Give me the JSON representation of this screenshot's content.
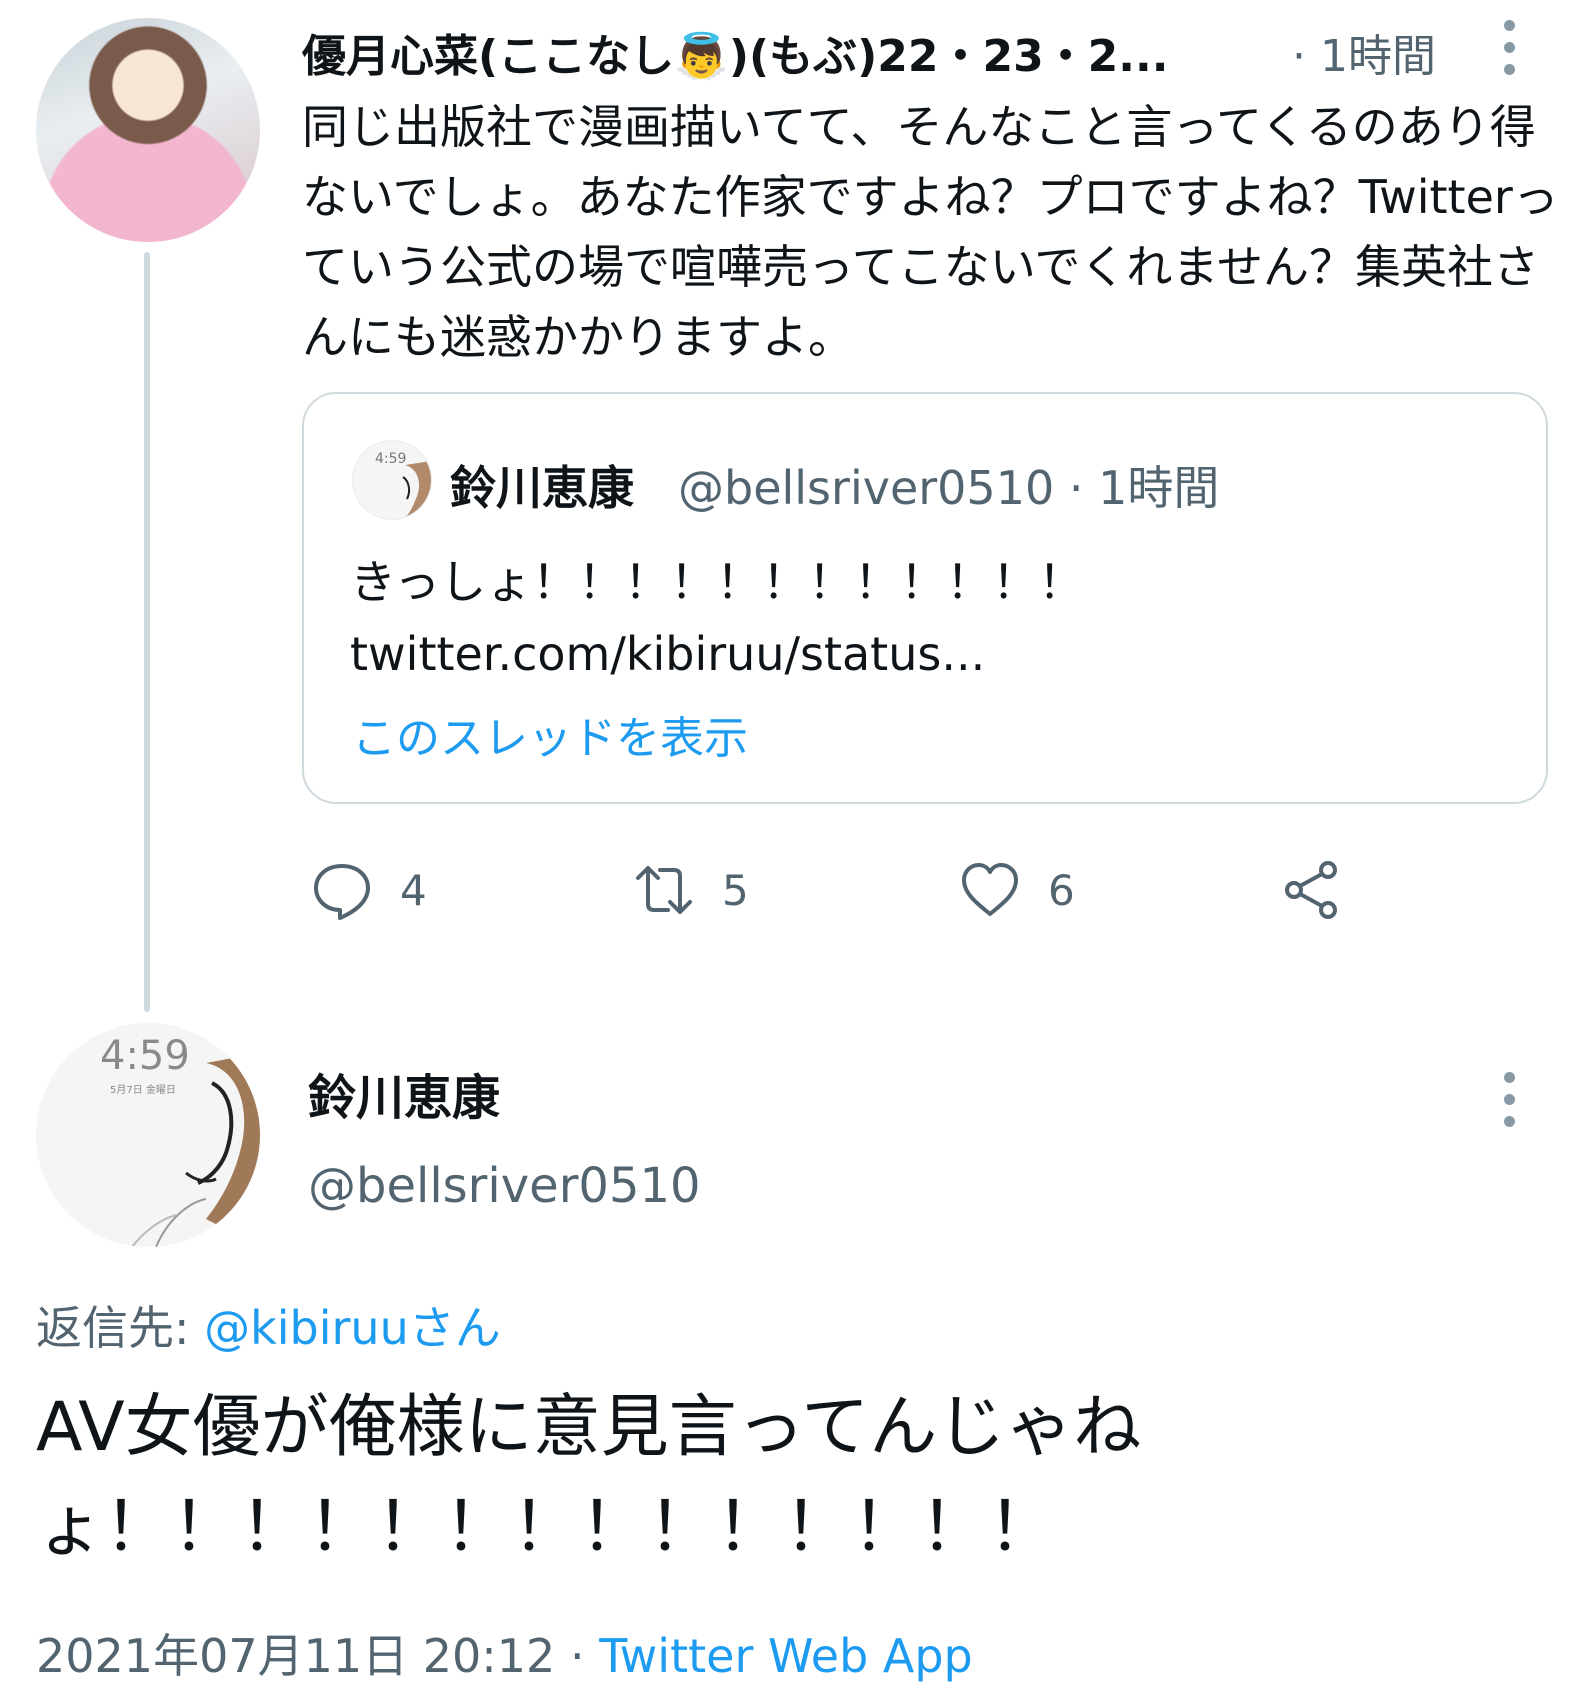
{
  "tweet1": {
    "display_name": "優月心菜(ここなし👼)(もぶ)22・23・2...",
    "time": "· 1時間",
    "text": "同じ出版社で漫画描いてて、そんなこと言ってくるのあり得ないでしょ。あなた作家ですよね？プロですよね？Twitterっていう公式の場で喧嘩売ってこないでくれません？集英社さんにも迷惑かかりますよ。",
    "quote": {
      "name": "鈴川恵康",
      "handle_time": "@bellsriver0510 · 1時間",
      "text": "きっしょ！！！！！！！！！！！！",
      "link": " twitter.com/kibiruu/status...",
      "show_thread": "このスレッドを表示",
      "avatar_clock": "4:59"
    },
    "actions": {
      "replies": "4",
      "retweets": "5",
      "likes": "6"
    }
  },
  "tweet2": {
    "display_name": "鈴川恵康",
    "handle": "@bellsriver0510",
    "avatar_clock": "4:59",
    "avatar_date": "5月7日 金曜日",
    "reply_label": "返信先: ",
    "reply_mention": "@kibiruuさん",
    "text": "AV女優が俺様に意見言ってんじゃねょ！！！！！！！！！！！！！！",
    "date": "2021年07月11日 20:12 · ",
    "source": "Twitter Web App"
  },
  "colors": {
    "accent": "#1d9bf0",
    "secondary": "#536471",
    "border": "#cfd9de"
  }
}
